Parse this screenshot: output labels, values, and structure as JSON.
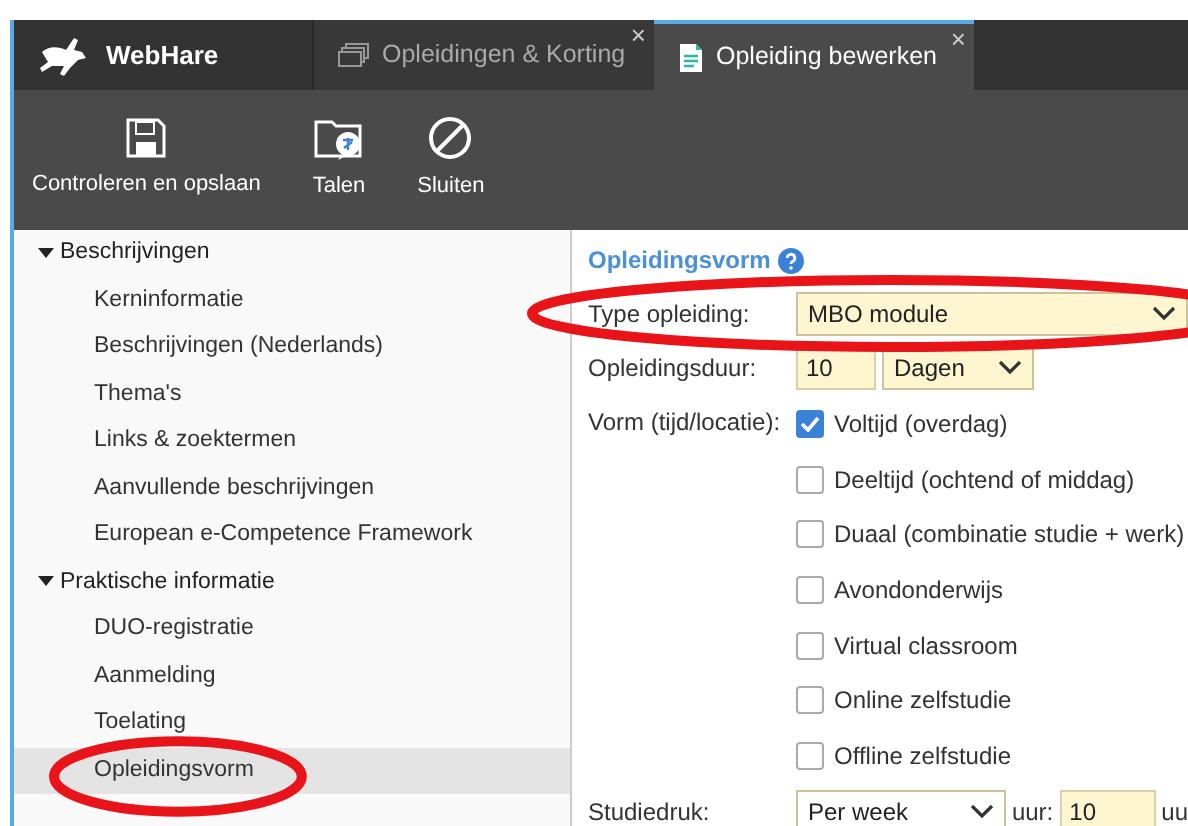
{
  "app": {
    "name": "WebHare"
  },
  "tabs": [
    {
      "label": "Opleidingen & Korting",
      "selected": false,
      "kind": "list",
      "close": "×"
    },
    {
      "label": "Opleiding bewerken",
      "selected": true,
      "kind": "document",
      "close": "×"
    }
  ],
  "toolbar": [
    {
      "label": "Controleren en opslaan",
      "kind": "save"
    },
    {
      "label": "Talen",
      "kind": "languages"
    },
    {
      "label": "Sluiten",
      "kind": "close"
    }
  ],
  "sidebar": [
    {
      "label": "Beschrijvingen",
      "expanded": true,
      "children": [
        {
          "label": "Kerninformatie",
          "selected": false,
          "highlighted": false
        },
        {
          "label": "Beschrijvingen (Nederlands)",
          "selected": false,
          "highlighted": false
        },
        {
          "label": "Thema's",
          "selected": false,
          "highlighted": false
        },
        {
          "label": "Links & zoektermen",
          "selected": false,
          "highlighted": false
        },
        {
          "label": "Aanvullende beschrijvingen",
          "selected": false,
          "highlighted": false
        },
        {
          "label": "European e-Competence Framework",
          "selected": false,
          "highlighted": false
        }
      ]
    },
    {
      "label": "Praktische informatie",
      "expanded": true,
      "children": [
        {
          "label": "DUO-registratie",
          "selected": false,
          "highlighted": false
        },
        {
          "label": "Aanmelding",
          "selected": false,
          "highlighted": false
        },
        {
          "label": "Toelating",
          "selected": false,
          "highlighted": false
        },
        {
          "label": "Opleidingsvorm",
          "selected": true,
          "highlighted": true
        }
      ]
    }
  ],
  "form": {
    "title": "Opleidingsvorm",
    "fields": [
      {
        "kind": "select",
        "label": "Type opleiding:",
        "value": "MBO module",
        "highlighted": true
      },
      {
        "kind": "duration",
        "label": "Opleidingsduur:",
        "value": "10",
        "unit": "Dagen",
        "highlighted": false
      },
      {
        "kind": "checkboxes",
        "label": "Vorm (tijd/locatie):",
        "highlighted": false,
        "options": [
          {
            "label": "Voltijd (overdag)",
            "checked": true
          },
          {
            "label": "Deeltijd (ochtend of middag)",
            "checked": false
          },
          {
            "label": "Duaal (combinatie studie + werk)",
            "checked": false
          },
          {
            "label": "Avondonderwijs",
            "checked": false
          },
          {
            "label": "Virtual classroom",
            "checked": false
          },
          {
            "label": "Online zelfstudie",
            "checked": false
          },
          {
            "label": "Offline zelfstudie",
            "checked": false
          }
        ]
      },
      {
        "kind": "rate",
        "label": "Studiedruk:",
        "period": "Per week",
        "unit_label": "uur:",
        "value": "10",
        "suffix": "uu",
        "highlighted": false
      }
    ]
  }
}
